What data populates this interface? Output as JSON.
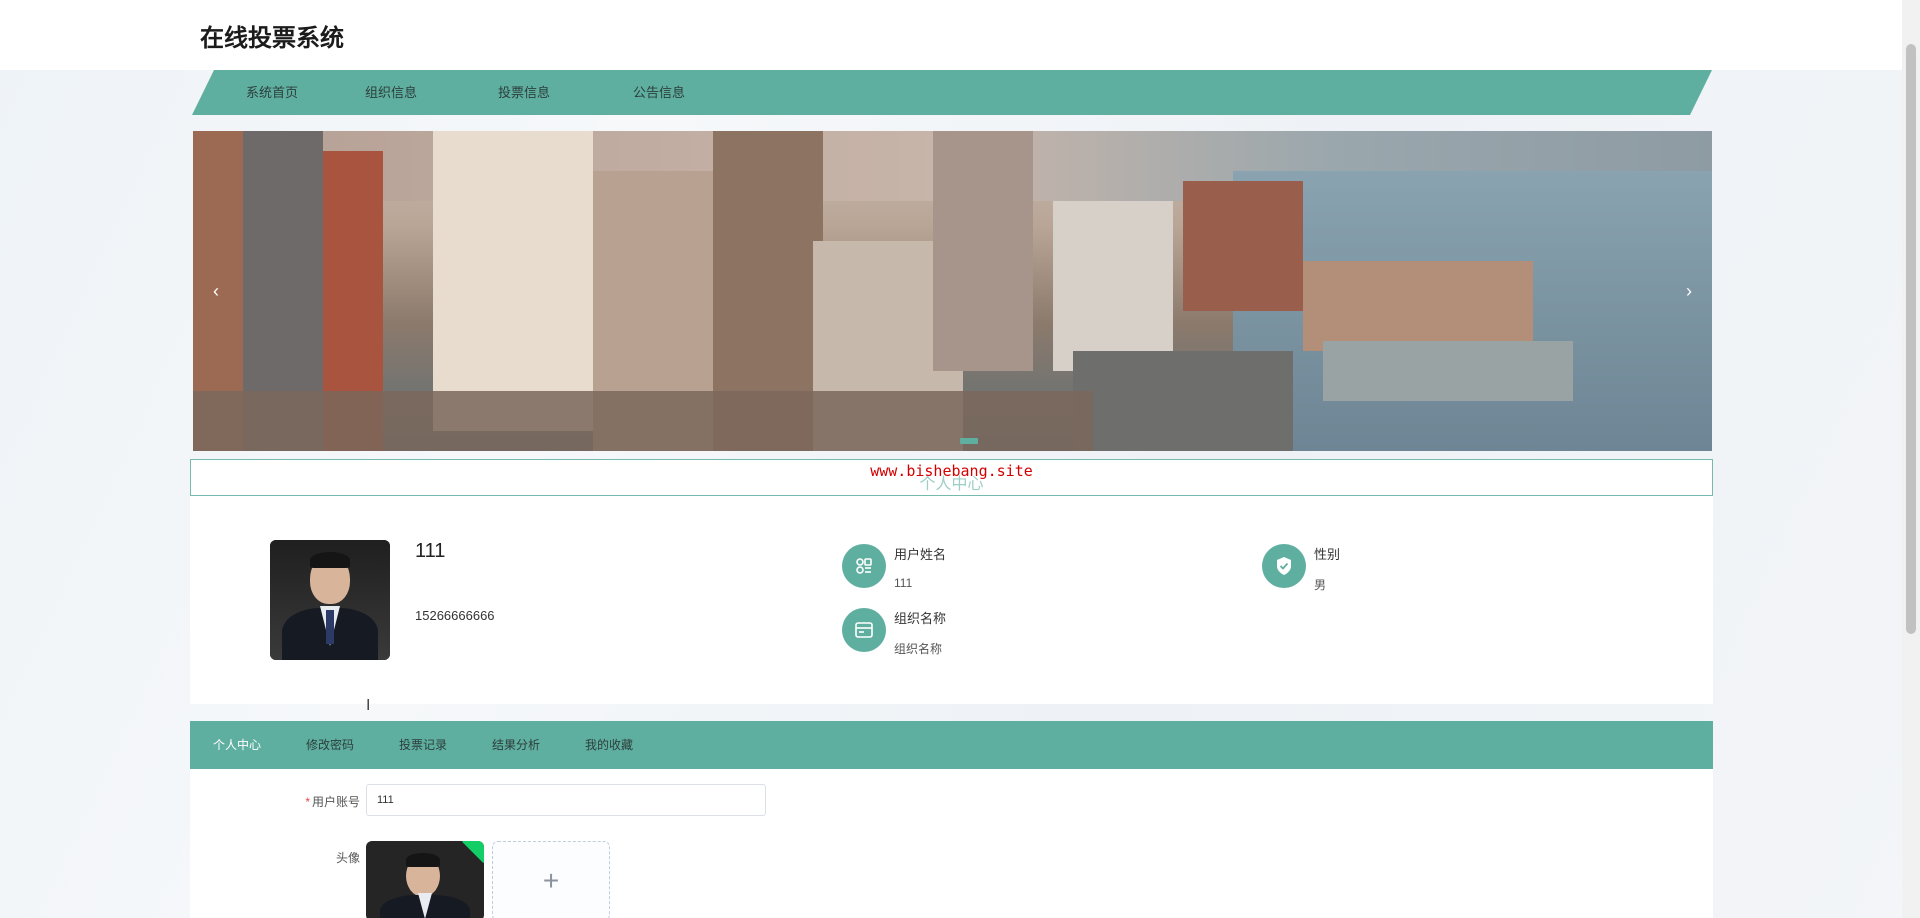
{
  "site": {
    "title": "在线投票系统"
  },
  "nav": {
    "items": [
      {
        "label": "系统首页"
      },
      {
        "label": "组织信息"
      },
      {
        "label": "投票信息"
      },
      {
        "label": "公告信息"
      }
    ]
  },
  "banner": {
    "prev": "‹",
    "next": "›"
  },
  "center": {
    "title": "个人中心",
    "watermark": "www.bishebang.site"
  },
  "profile": {
    "name": "111",
    "phone": "15266666666",
    "fields": [
      {
        "label": "用户姓名",
        "value": "111",
        "icon": "user-card-icon"
      },
      {
        "label": "性别",
        "value": "男",
        "icon": "shield-check-icon"
      },
      {
        "label": "组织名称",
        "value": "组织名称",
        "icon": "id-card-icon"
      }
    ]
  },
  "tabs": {
    "items": [
      {
        "label": "个人中心"
      },
      {
        "label": "修改密码"
      },
      {
        "label": "投票记录"
      },
      {
        "label": "结果分析"
      },
      {
        "label": "我的收藏"
      }
    ]
  },
  "form": {
    "account_label": "用户账号",
    "account_required_mark": "*",
    "account_value": "111",
    "avatar_label": "头像",
    "upload_add_symbol": "+"
  },
  "colors": {
    "accent": "#5fafa1",
    "watermark": "#d40000",
    "success": "#13ce66"
  }
}
